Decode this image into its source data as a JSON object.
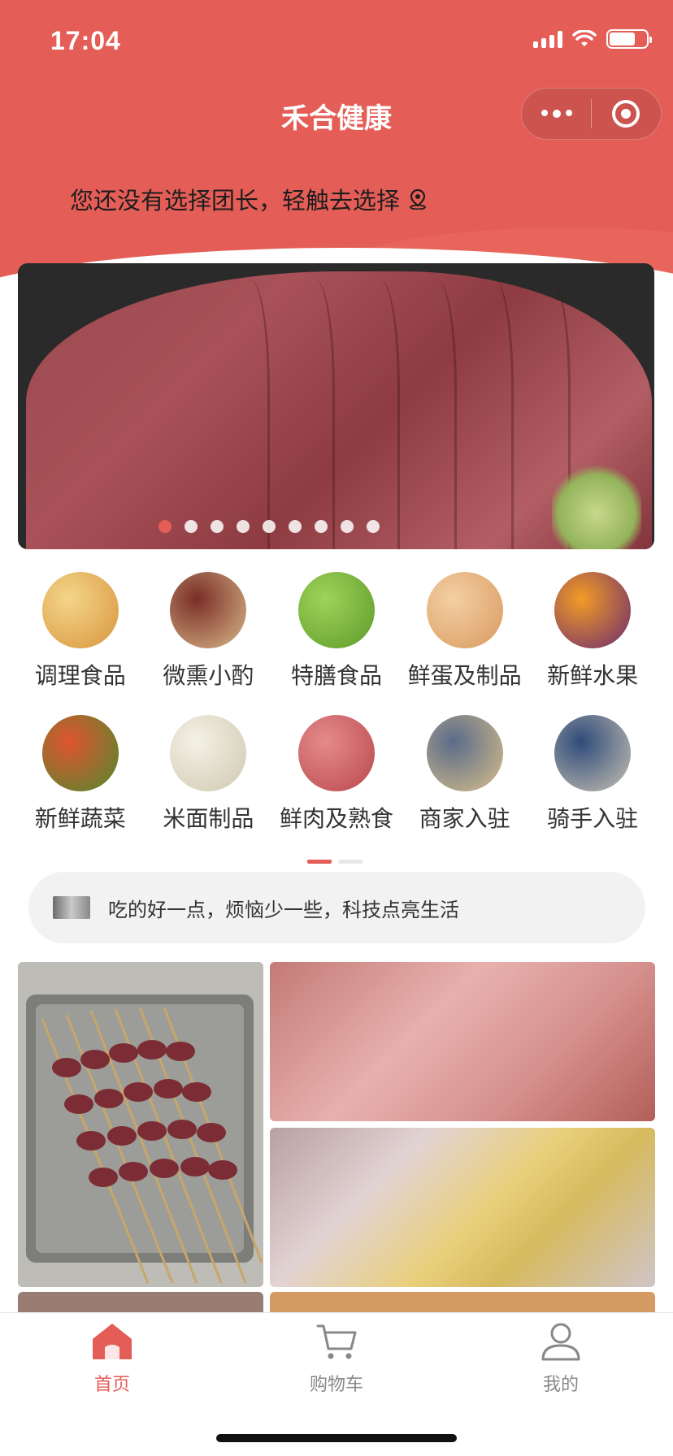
{
  "status_bar": {
    "time": "17:04"
  },
  "nav": {
    "title": "禾合健康"
  },
  "leader_prompt": {
    "text": "您还没有选择团长，轻触去选择"
  },
  "banner": {
    "dot_count": 9,
    "active_index": 0
  },
  "categories": [
    {
      "label": "调理食品",
      "icon": "fried-chicken-icon",
      "colors": [
        "#f4d58a",
        "#d8953c"
      ]
    },
    {
      "label": "微熏小酌",
      "icon": "wine-icon",
      "colors": [
        "#7a2d26",
        "#d9b98a"
      ]
    },
    {
      "label": "特膳食品",
      "icon": "green-fruit-icon",
      "colors": [
        "#9fd35a",
        "#5d9a2a"
      ]
    },
    {
      "label": "鲜蛋及制品",
      "icon": "eggs-icon",
      "colors": [
        "#f3cfa3",
        "#d99a5f"
      ]
    },
    {
      "label": "新鲜水果",
      "icon": "fruits-icon",
      "colors": [
        "#f29c26",
        "#6b2a6f"
      ]
    },
    {
      "label": "新鲜蔬菜",
      "icon": "vegetables-icon",
      "colors": [
        "#e0542f",
        "#4f8a2e"
      ]
    },
    {
      "label": "米面制品",
      "icon": "buns-icon",
      "colors": [
        "#f4f1e6",
        "#cfc8b0"
      ]
    },
    {
      "label": "鲜肉及熟食",
      "icon": "meat-icon",
      "colors": [
        "#e58a8a",
        "#b8484e"
      ]
    },
    {
      "label": "商家入驻",
      "icon": "store-icon",
      "colors": [
        "#5b6b8a",
        "#d8c08a"
      ]
    },
    {
      "label": "骑手入驻",
      "icon": "rider-icon",
      "colors": [
        "#2f4b7a",
        "#c9c2b3"
      ]
    }
  ],
  "notice": {
    "text": "吃的好一点，烦恼少一些，科技点亮生活"
  },
  "tabbar": {
    "items": [
      {
        "label": "首页",
        "icon": "home-icon",
        "active": true
      },
      {
        "label": "购物车",
        "icon": "cart-icon",
        "active": false
      },
      {
        "label": "我的",
        "icon": "user-icon",
        "active": false
      }
    ]
  },
  "colors": {
    "brand": "#e55d57",
    "background": "#ffffff",
    "text": "#333333"
  }
}
